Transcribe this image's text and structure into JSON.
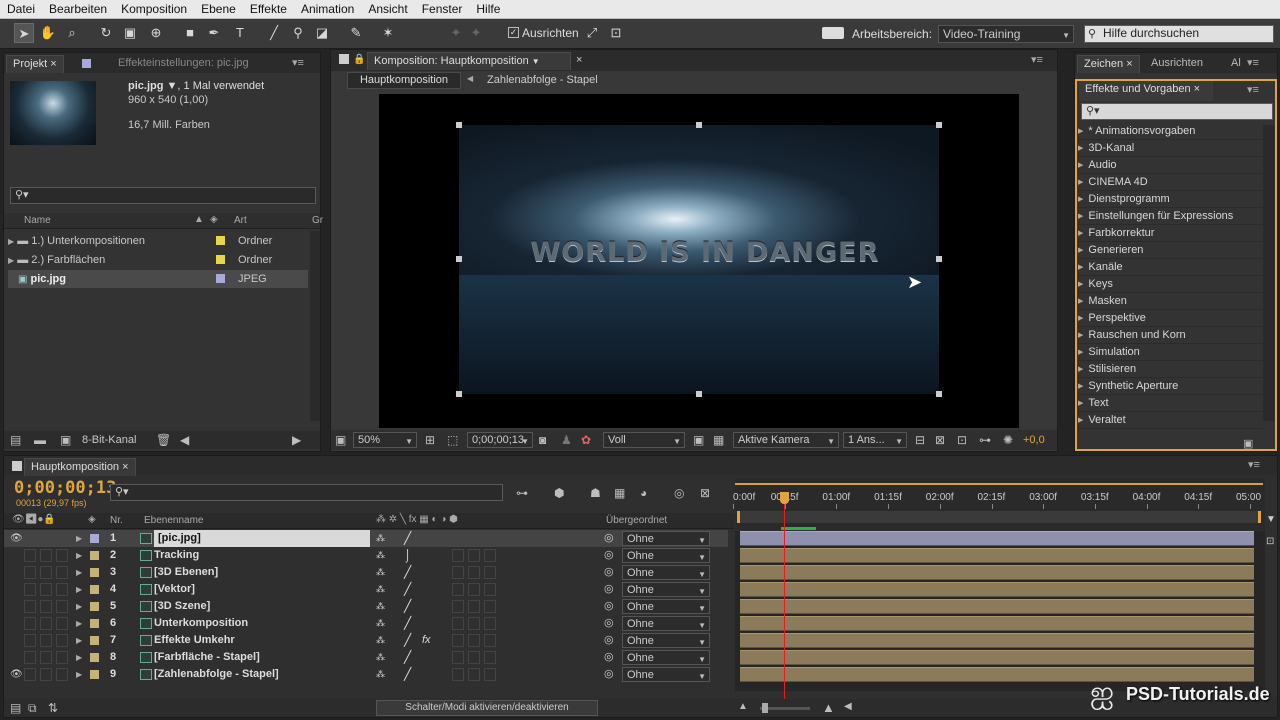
{
  "menu": [
    "Datei",
    "Bearbeiten",
    "Komposition",
    "Ebene",
    "Effekte",
    "Animation",
    "Ansicht",
    "Fenster",
    "Hilfe"
  ],
  "toolbar": {
    "ausrichten_label": "Ausrichten",
    "workspace_label": "Arbeitsbereich:",
    "workspace_value": "Video-Training",
    "help_placeholder": "Hilfe durchsuchen"
  },
  "project_panel": {
    "tab_projekt": "Projekt",
    "tab_effekteinstellungen": "Effekteinstellungen: pic.jpg",
    "asset_name": "pic.jpg",
    "asset_usage": ", 1 Mal verwendet",
    "asset_size": "960 x 540 (1,00)",
    "asset_colors": "16,7 Mill. Farben",
    "col_name": "Name",
    "col_art": "Art",
    "col_gr": "Gr",
    "items": [
      {
        "name": "1.) Unterkompositionen",
        "type": "Ordner",
        "color": "#e6d64b"
      },
      {
        "name": "2.) Farbflächen",
        "type": "Ordner",
        "color": "#e6d64b"
      },
      {
        "name": "pic.jpg",
        "type": "JPEG",
        "color": "#a9a9d8"
      }
    ],
    "bit_depth": "8-Bit-Kanal"
  },
  "comp_panel": {
    "tab_label": "Komposition: Hauptkomposition",
    "breadcrumb_main": "Hauptkomposition",
    "breadcrumb_sub": "Zahlenabfolge - Stapel",
    "overlay_text": "WORLD IS IN DANGER",
    "zoom": "50%",
    "timecode": "0;00;00;13",
    "resolution": "Voll",
    "camera": "Aktive Kamera",
    "views": "1 Ans...",
    "exposure": "+0,0"
  },
  "effects_panel": {
    "tab_zeichen": "Zeichen",
    "tab_ausrichten": "Ausrichten",
    "tab_al": "Al",
    "title": "Effekte und Vorgaben",
    "categories": [
      "* Animationsvorgaben",
      "3D-Kanal",
      "Audio",
      "CINEMA 4D",
      "Dienstprogramm",
      "Einstellungen für Expressions",
      "Farbkorrektur",
      "Generieren",
      "Kanäle",
      "Keys",
      "Masken",
      "Perspektive",
      "Rauschen und Korn",
      "Simulation",
      "Stilisieren",
      "Synthetic Aperture",
      "Text",
      "Veraltet"
    ]
  },
  "timeline": {
    "tab_label": "Hauptkomposition",
    "timecode": "0;00;00;13",
    "fps": "00013 (29,97 fps)",
    "col_nr": "Nr.",
    "col_layer": "Ebenenname",
    "col_parent": "Übergeordnet",
    "ruler": [
      "0:00f",
      "00:15f",
      "01:00f",
      "01:15f",
      "02:00f",
      "02:15f",
      "03:00f",
      "03:15f",
      "04:00f",
      "04:15f",
      "05:00"
    ],
    "playhead_fraction": 0.087,
    "layers": [
      {
        "nr": "1",
        "name": "[pic.jpg]",
        "color": "#a9a9d8",
        "parent": "Ohne"
      },
      {
        "nr": "2",
        "name": "Tracking",
        "color": "#c8b07a",
        "parent": "Ohne"
      },
      {
        "nr": "3",
        "name": "[3D Ebenen]",
        "color": "#c8b07a",
        "parent": "Ohne"
      },
      {
        "nr": "4",
        "name": "[Vektor]",
        "color": "#c8b07a",
        "parent": "Ohne"
      },
      {
        "nr": "5",
        "name": "[3D Szene]",
        "color": "#c8b07a",
        "parent": "Ohne"
      },
      {
        "nr": "6",
        "name": "Unterkomposition",
        "color": "#c8b07a",
        "parent": "Ohne"
      },
      {
        "nr": "7",
        "name": "Effekte Umkehr",
        "color": "#c8b07a",
        "parent": "Ohne"
      },
      {
        "nr": "8",
        "name": "[Farbfläche - Stapel]",
        "color": "#c8b07a",
        "parent": "Ohne"
      },
      {
        "nr": "9",
        "name": "[Zahlenabfolge - Stapel]",
        "color": "#c8b07a",
        "parent": "Ohne"
      }
    ],
    "switch_toggle_label": "Schalter/Modi aktivieren/deaktivieren"
  },
  "watermark": "PSD-Tutorials.de"
}
